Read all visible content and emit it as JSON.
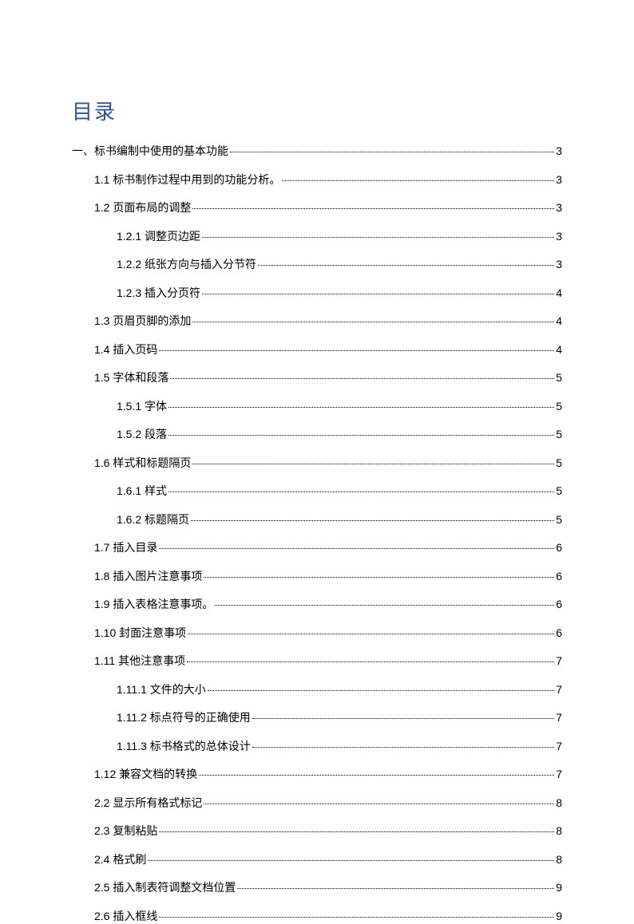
{
  "title": "目录",
  "entries": [
    {
      "level": 0,
      "label": "一、标书编制中使用的基本功能",
      "page": "3"
    },
    {
      "level": 1,
      "label": "1.1 标书制作过程中用到的功能分析。",
      "page": "3"
    },
    {
      "level": 1,
      "label": "1.2 页面布局的调整",
      "page": "3"
    },
    {
      "level": 2,
      "label": "1.2.1 调整页边距",
      "page": "3"
    },
    {
      "level": 2,
      "label": "1.2.2 纸张方向与插入分节符",
      "page": "3"
    },
    {
      "level": 2,
      "label": "1.2.3 插入分页符",
      "page": "4"
    },
    {
      "level": 1,
      "label": "1.3 页眉页脚的添加",
      "page": "4"
    },
    {
      "level": 1,
      "label": "1.4 插入页码",
      "page": "4"
    },
    {
      "level": 1,
      "label": "1.5 字体和段落",
      "page": "5"
    },
    {
      "level": 2,
      "label": "1.5.1 字体",
      "page": "5"
    },
    {
      "level": 2,
      "label": "1.5.2 段落",
      "page": "5"
    },
    {
      "level": 1,
      "label": "1.6 样式和标题隔页",
      "page": "5"
    },
    {
      "level": 2,
      "label": "1.6.1 样式",
      "page": "5"
    },
    {
      "level": 2,
      "label": "1.6.2 标题隔页",
      "page": "5"
    },
    {
      "level": 1,
      "label": "1.7 插入目录",
      "page": "6"
    },
    {
      "level": 1,
      "label": "1.8 插入图片注意事项",
      "page": "6"
    },
    {
      "level": 1,
      "label": "1.9 插入表格注意事项。",
      "page": "6"
    },
    {
      "level": 1,
      "label": "1.10 封面注意事项",
      "page": "6"
    },
    {
      "level": 1,
      "label": "1.11 其他注意事项",
      "page": "7"
    },
    {
      "level": 2,
      "label": "1.11.1 文件的大小",
      "page": "7"
    },
    {
      "level": 2,
      "label": "1.11.2 标点符号的正确使用",
      "page": "7"
    },
    {
      "level": 2,
      "label": "1.11.3 标书格式的总体设计",
      "page": "7"
    },
    {
      "level": 1,
      "label": "1.12 兼容文档的转换",
      "page": "7"
    },
    {
      "level": 1,
      "label": "2.2 显示所有格式标记",
      "page": "8"
    },
    {
      "level": 1,
      "label": "2.3 复制粘贴",
      "page": "8"
    },
    {
      "level": 1,
      "label": "2.4 格式刷",
      "page": "8"
    },
    {
      "level": 1,
      "label": "2.5 插入制表符调整文档位置",
      "page": "9"
    },
    {
      "level": 1,
      "label": "2.6 插入框线",
      "page": "9"
    }
  ]
}
